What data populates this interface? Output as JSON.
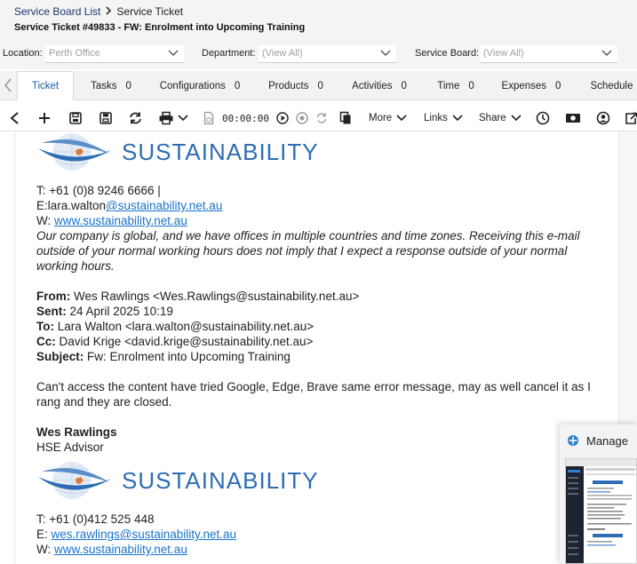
{
  "breadcrumb": {
    "parent": "Service Board List",
    "current": "Service Ticket"
  },
  "ticket_title": "Service Ticket #49833 - FW: Enrolment into Upcoming Training",
  "filters": {
    "location_label": "Location:",
    "location_value": "Perth Office",
    "department_label": "Department:",
    "department_value": "(View All)",
    "board_label": "Service Board:",
    "board_value": "(View All)"
  },
  "tabs": [
    {
      "label": "Ticket",
      "count": ""
    },
    {
      "label": "Tasks",
      "count": "0"
    },
    {
      "label": "Configurations",
      "count": "0"
    },
    {
      "label": "Products",
      "count": "0"
    },
    {
      "label": "Activities",
      "count": "0"
    },
    {
      "label": "Time",
      "count": "0"
    },
    {
      "label": "Expenses",
      "count": "0"
    },
    {
      "label": "Schedule",
      "count": ""
    }
  ],
  "toolbar": {
    "timer": "00:00:00",
    "more": "More",
    "links": "Links",
    "share": "Share"
  },
  "email": {
    "logo_text": "SUSTAINABILITY",
    "sig1_phone": "T: +61 (0)8 9246 6666   |",
    "sig1_email_prefix": "E:lara.walton",
    "sig1_email_link": "@sustainability.net.au",
    "sig1_web_prefix": "W: ",
    "sig1_web_link": "www.sustainability.net.au",
    "disclaimer": "Our company is global, and we have offices in multiple countries and time zones. Receiving this e-mail outside of your normal working hours does not imply that I expect a response outside of your normal working hours.",
    "from_label": "From:",
    "from_value": " Wes Rawlings <Wes.Rawlings@sustainability.net.au>",
    "sent_label": "Sent:",
    "sent_value": " 24 April 2025 10:19",
    "to_label": "To:",
    "to_value": " Lara Walton <lara.walton@sustainability.net.au>",
    "cc_label": "Cc:",
    "cc_value": " David Krige <david.krige@sustainability.net.au>",
    "subject_label": "Subject:",
    "subject_value": " Fw: Enrolment into Upcoming Training",
    "message": "Can't access the content have tried Google, Edge, Brave same error message, may as well cancel it as I rang and they are closed.",
    "sender_name": "Wes Rawlings",
    "sender_title": "HSE Advisor",
    "sig2_phone": "T: +61 (0)412 525 448",
    "sig2_email_prefix": "E: ",
    "sig2_email_link": "wes.rawlings@sustainability.net.au",
    "sig2_web_prefix": "W: ",
    "sig2_web_link": "www.sustainability.net.au"
  },
  "manage_popup": {
    "label": "Manage"
  },
  "colors": {
    "link": "#1a73c9",
    "logo": "#2e6db3",
    "active_tab": "#1f5fa8"
  }
}
